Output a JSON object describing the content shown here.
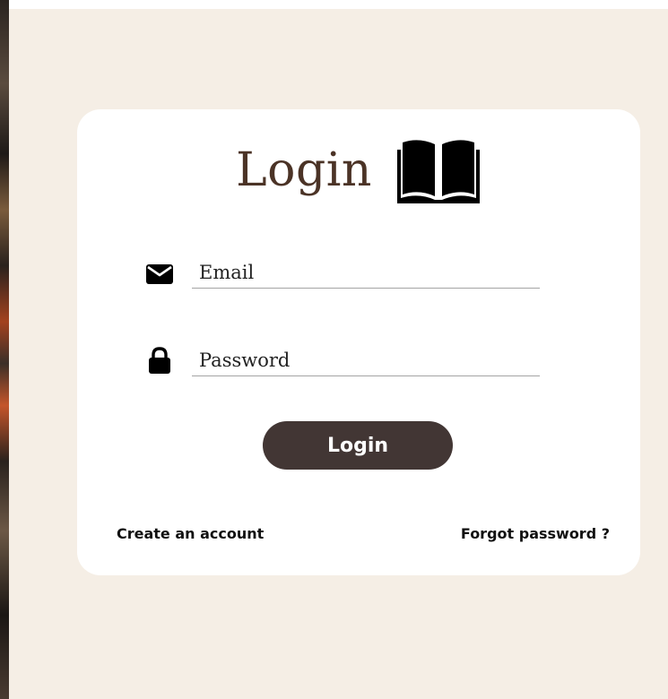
{
  "login_card": {
    "title": "Login",
    "title_icon": "open-book-icon",
    "email_field": {
      "icon": "envelope-icon",
      "placeholder": "Email",
      "value": ""
    },
    "password_field": {
      "icon": "lock-icon",
      "placeholder": "Password",
      "value": ""
    },
    "submit_label": "Login",
    "create_account_link": "Create an account",
    "forgot_password_link": "Forgot password ?"
  },
  "colors": {
    "page_background": "#f5eee5",
    "card_background": "#ffffff",
    "title_color": "#4b3326",
    "button_background": "#423634",
    "button_text": "#ffffff",
    "underline": "#a4a4a4"
  }
}
